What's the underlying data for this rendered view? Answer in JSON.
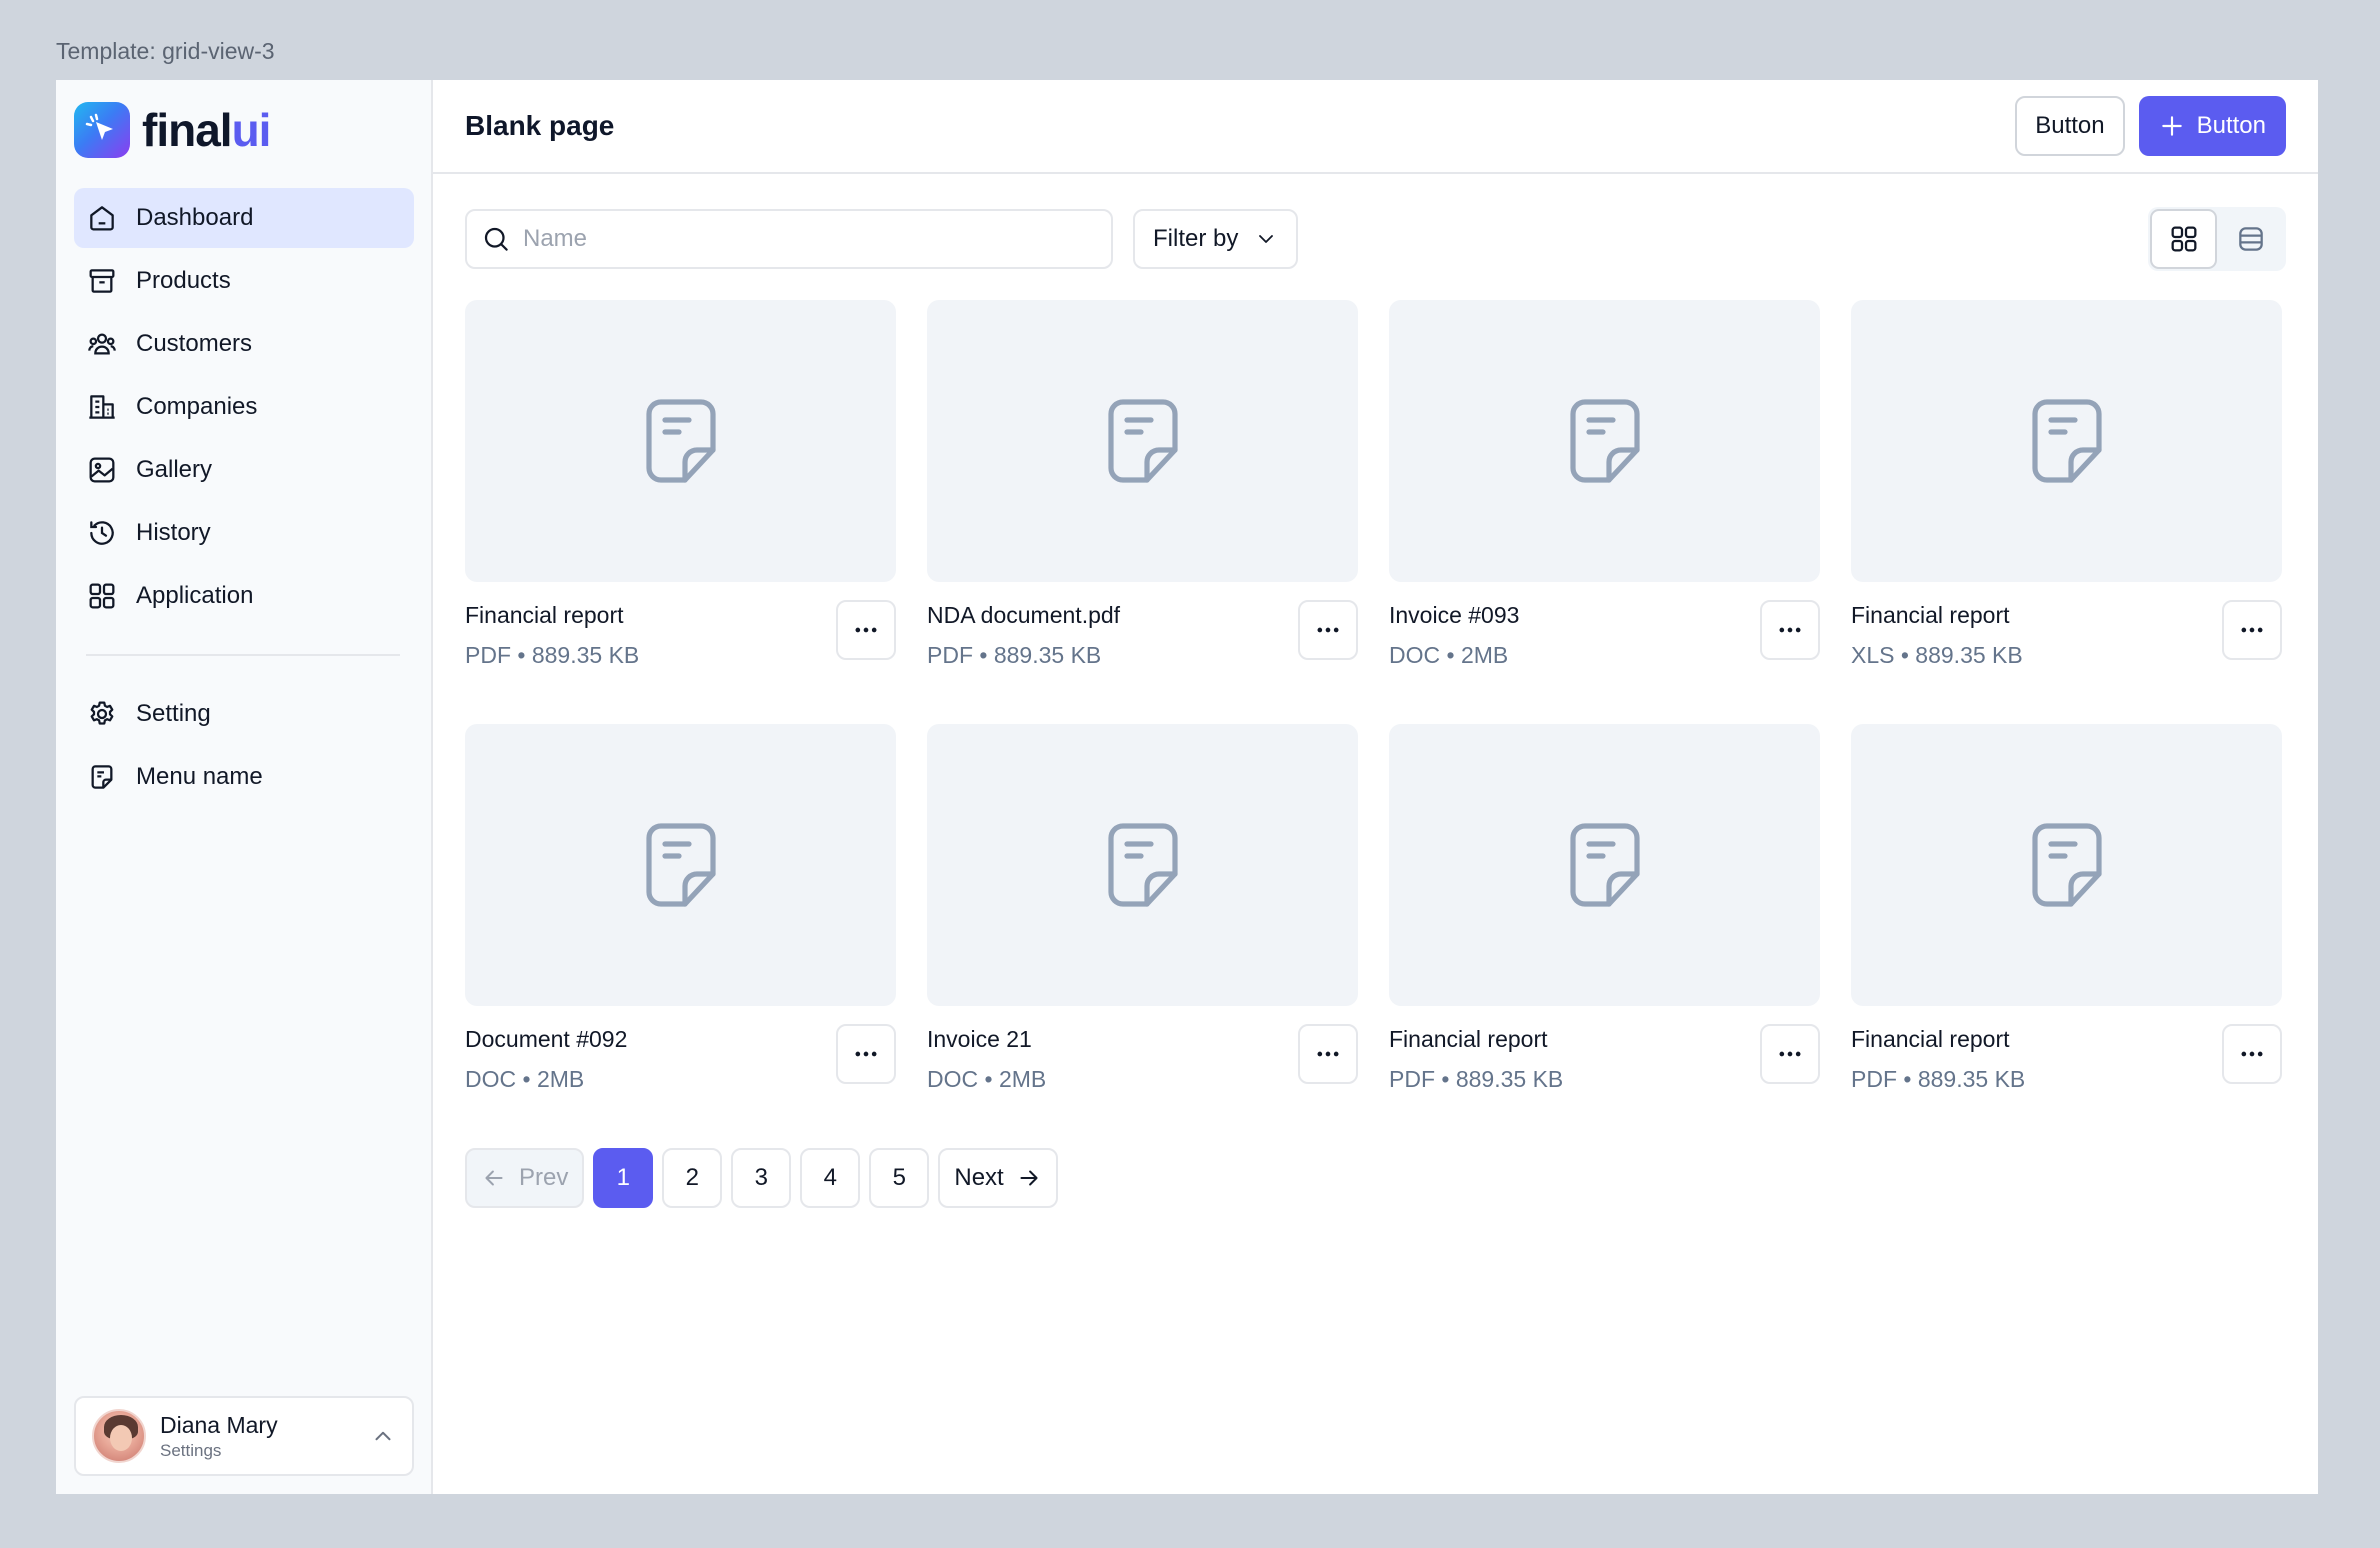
{
  "template_label": "Template: grid-view-3",
  "brand": {
    "name_main": "final",
    "name_accent": "ui",
    "accent_color": "#5b5cf0"
  },
  "sidebar": {
    "items": [
      {
        "label": "Dashboard",
        "icon": "home-icon",
        "active": true
      },
      {
        "label": "Products",
        "icon": "archive-icon"
      },
      {
        "label": "Customers",
        "icon": "users-icon"
      },
      {
        "label": "Companies",
        "icon": "building-icon"
      },
      {
        "label": "Gallery",
        "icon": "image-icon"
      },
      {
        "label": "History",
        "icon": "history-icon"
      },
      {
        "label": "Application",
        "icon": "grid-icon"
      }
    ],
    "secondary_items": [
      {
        "label": "Setting",
        "icon": "gear-icon"
      },
      {
        "label": "Menu name",
        "icon": "note-icon"
      }
    ],
    "user": {
      "name": "Diana Mary",
      "subtitle": "Settings"
    }
  },
  "header": {
    "title": "Blank page",
    "secondary_button": "Button",
    "primary_button": "Button"
  },
  "toolbar": {
    "search_placeholder": "Name",
    "filter_label": "Filter by",
    "view_mode": "grid"
  },
  "files": [
    {
      "title": "Financial report",
      "meta": "PDF • 889.35 KB"
    },
    {
      "title": "NDA document.pdf",
      "meta": "PDF • 889.35 KB"
    },
    {
      "title": "Invoice #093",
      "meta": "DOC • 2MB"
    },
    {
      "title": "Financial report",
      "meta": "XLS • 889.35 KB"
    },
    {
      "title": "Document #092",
      "meta": "DOC • 2MB"
    },
    {
      "title": "Invoice 21",
      "meta": "DOC • 2MB"
    },
    {
      "title": "Financial report",
      "meta": "PDF • 889.35 KB"
    },
    {
      "title": "Financial report",
      "meta": "PDF • 889.35 KB"
    }
  ],
  "pagination": {
    "prev_label": "Prev",
    "next_label": "Next",
    "pages": [
      "1",
      "2",
      "3",
      "4",
      "5"
    ],
    "current": "1"
  }
}
